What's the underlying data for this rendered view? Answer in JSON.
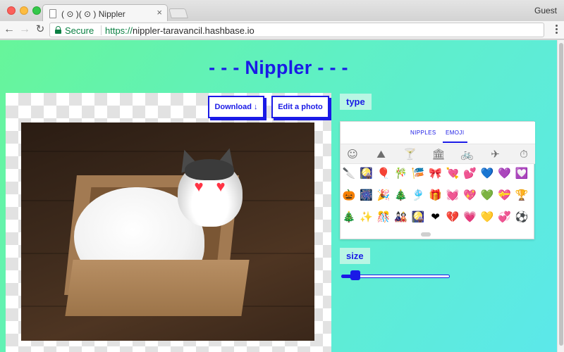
{
  "browser": {
    "tab_title": "( ⊙ )( ⊙ ) Nippler",
    "tab_close": "×",
    "profile_label": "Guest",
    "secure_label": "Secure",
    "url_scheme": "https://",
    "url_host": "nippler-taravancil.hashbase.io",
    "nav_back": "←",
    "nav_forward": "→",
    "nav_reload": "↻"
  },
  "page": {
    "title": "- - - Nippler - - -",
    "download_label": "Download ↓",
    "edit_label": "Edit a photo",
    "type_label": "type",
    "size_label": "size",
    "size_level_percent": 9
  },
  "picker": {
    "tabs": [
      "NIPPLES",
      "EMOJI"
    ],
    "active_tab": "EMOJI",
    "categories": [
      {
        "icon": "smiley-icon",
        "glyph": "☺"
      },
      {
        "icon": "mountain-icon",
        "glyph": "⛰"
      },
      {
        "icon": "cocktail-icon",
        "glyph": "🍸"
      },
      {
        "icon": "building-icon",
        "glyph": "🏛"
      },
      {
        "icon": "bicycle-icon",
        "glyph": "🚲"
      },
      {
        "icon": "airplane-icon",
        "glyph": "✈"
      },
      {
        "icon": "stopwatch-icon",
        "glyph": "⏱"
      }
    ],
    "emoji_rows": [
      [
        "🔪",
        "🎑",
        "🎈",
        "🎋",
        "🎏",
        "🎀",
        "💘",
        "💕",
        "💙",
        "💜",
        "💟"
      ],
      [
        "🎃",
        "🎆",
        "🎉",
        "🎄",
        "🎐",
        "🎁",
        "💓",
        "💖",
        "💚",
        "💝",
        "🏆"
      ],
      [
        "🎄",
        "✨",
        "🎊",
        "🎎",
        "🎑",
        "❤",
        "💔",
        "💗",
        "💛",
        "💞",
        "⚽"
      ]
    ]
  },
  "colors": {
    "accent": "#1a1ae6",
    "heart": "#ff3344"
  }
}
